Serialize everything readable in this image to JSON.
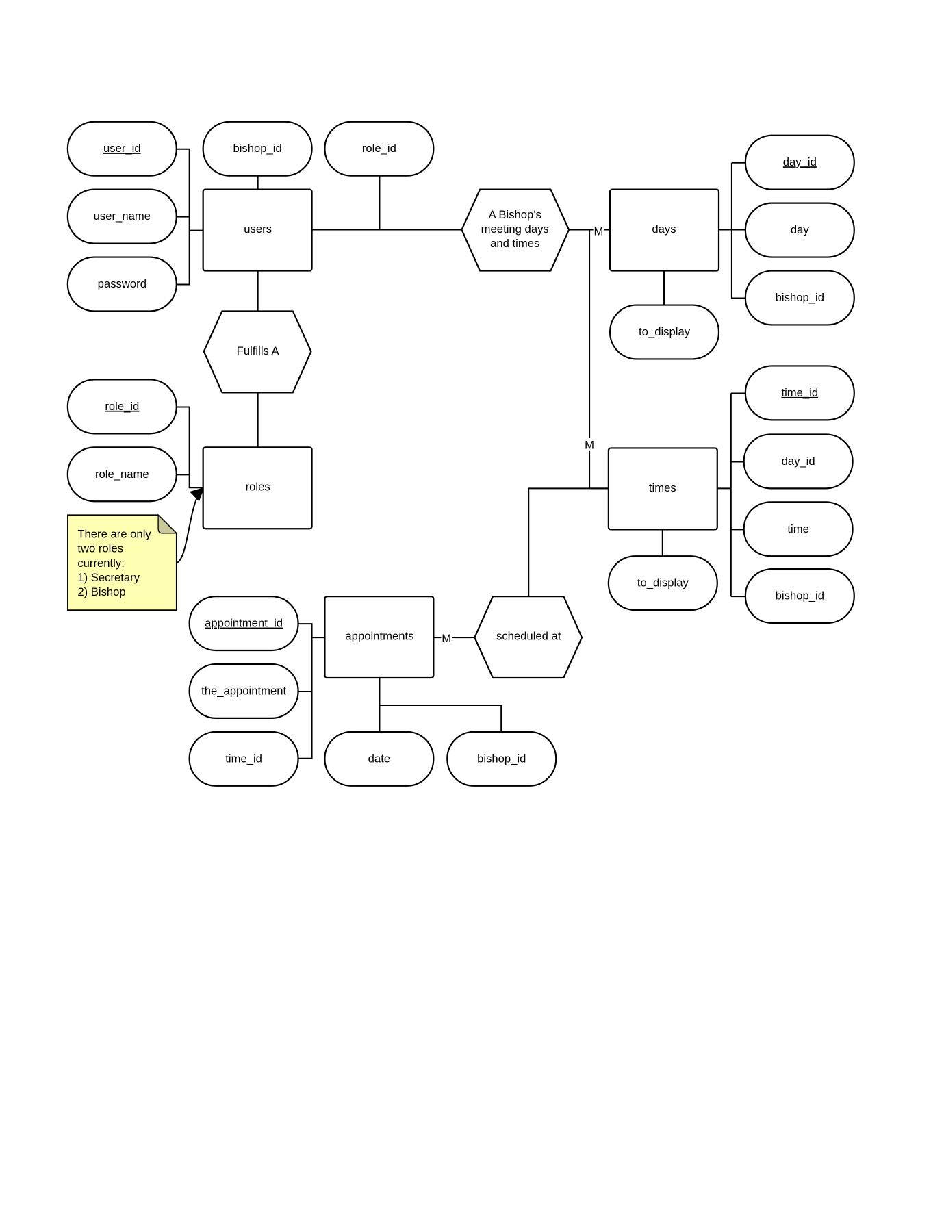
{
  "entities": {
    "users": "users",
    "roles": "roles",
    "days": "days",
    "times": "times",
    "appointments": "appointments"
  },
  "relationships": {
    "fulfills": "Fulfills A",
    "meeting": [
      "A Bishop's",
      "meeting days",
      "and times"
    ],
    "scheduled": "scheduled at"
  },
  "attributes": {
    "users": [
      {
        "label": "user_id",
        "key": true
      },
      {
        "label": "user_name",
        "key": false
      },
      {
        "label": "password",
        "key": false
      },
      {
        "label": "bishop_id",
        "key": false
      },
      {
        "label": "role_id",
        "key": false
      }
    ],
    "roles": [
      {
        "label": "role_id",
        "key": true
      },
      {
        "label": "role_name",
        "key": false
      }
    ],
    "days": [
      {
        "label": "day_id",
        "key": true
      },
      {
        "label": "day",
        "key": false
      },
      {
        "label": "bishop_id",
        "key": false
      },
      {
        "label": "to_display",
        "key": false
      }
    ],
    "times": [
      {
        "label": "time_id",
        "key": true
      },
      {
        "label": "day_id",
        "key": false
      },
      {
        "label": "time",
        "key": false
      },
      {
        "label": "bishop_id",
        "key": false
      },
      {
        "label": "to_display",
        "key": false
      }
    ],
    "appointments": [
      {
        "label": "appointment_id",
        "key": true
      },
      {
        "label": "the_appointment",
        "key": false
      },
      {
        "label": "time_id",
        "key": false
      },
      {
        "label": "date",
        "key": false
      },
      {
        "label": "bishop_id",
        "key": false
      }
    ]
  },
  "cardinality": {
    "meeting_days": "M",
    "meeting_times": "M",
    "appointments_scheduled": "M"
  },
  "note": {
    "lines": [
      "There are only",
      "two roles",
      "currently:",
      "1) Secretary",
      "2) Bishop"
    ],
    "color": "#ffffb3"
  }
}
